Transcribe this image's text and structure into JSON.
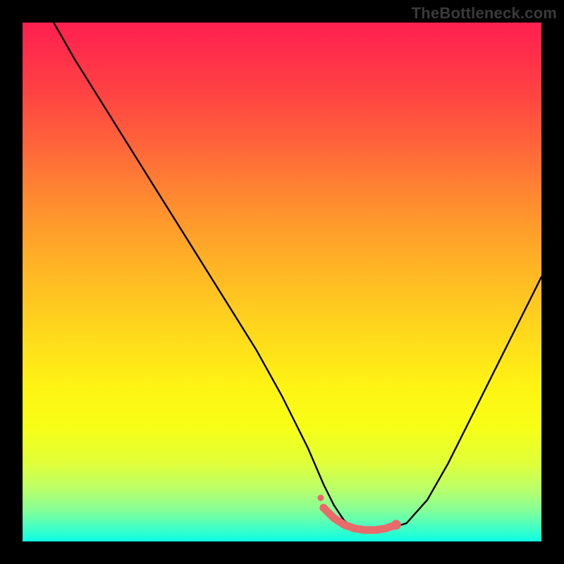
{
  "watermark": "TheBottleneck.com",
  "colors": {
    "background": "#000000",
    "curve": "#000000",
    "marker": "#e86a6a",
    "marker_outline": "#e86a6a"
  },
  "chart_data": {
    "type": "line",
    "title": "",
    "xlabel": "",
    "ylabel": "",
    "xlim": [
      0,
      100
    ],
    "ylim": [
      0,
      100
    ],
    "grid": false,
    "legend": false,
    "series": [
      {
        "name": "bottleneck-curve",
        "x": [
          6,
          10,
          15,
          20,
          25,
          30,
          35,
          40,
          45,
          50,
          55,
          58,
          60,
          62,
          64,
          66,
          68,
          70,
          74,
          78,
          82,
          86,
          90,
          94,
          98,
          100
        ],
        "values": [
          100,
          93,
          85,
          77,
          69,
          61,
          53,
          45,
          37,
          28,
          18,
          11,
          7,
          4,
          2.5,
          2,
          2,
          2.3,
          3.5,
          8,
          15,
          23,
          31,
          39,
          47,
          51
        ]
      }
    ],
    "markers": {
      "name": "highlight-segment",
      "x": [
        58,
        60,
        62,
        64,
        66,
        68,
        70,
        72
      ],
      "values": [
        6.5,
        4.5,
        3.2,
        2.5,
        2.2,
        2.2,
        2.5,
        3.2
      ]
    }
  }
}
